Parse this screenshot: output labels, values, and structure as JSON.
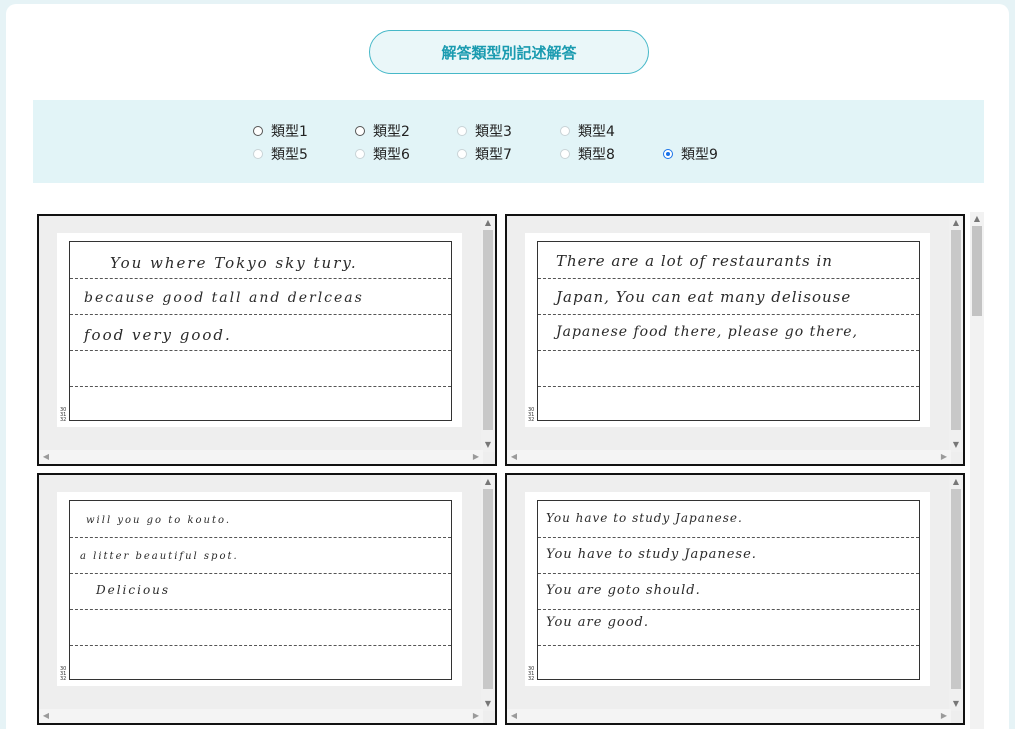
{
  "title": "解答類型別記述解答",
  "types": [
    {
      "label": "類型1",
      "state": "enabled"
    },
    {
      "label": "類型2",
      "state": "enabled"
    },
    {
      "label": "類型3",
      "state": "disabled"
    },
    {
      "label": "類型4",
      "state": "disabled"
    },
    {
      "label": "類型5",
      "state": "disabled"
    },
    {
      "label": "類型6",
      "state": "disabled"
    },
    {
      "label": "類型7",
      "state": "disabled"
    },
    {
      "label": "類型8",
      "state": "disabled"
    },
    {
      "label": "類型9",
      "state": "checked"
    }
  ],
  "answers": [
    {
      "lines": [
        "You where Tokyo sky tury.",
        "because good tall and derlceas",
        "food very good."
      ]
    },
    {
      "lines": [
        "There are a lot of restaurants in",
        "Japan, You can eat many delisouse",
        "Japanese food there, please go there,"
      ]
    },
    {
      "lines": [
        "will you go to kouto.",
        "a litter beautiful spot.",
        "Delicious"
      ]
    },
    {
      "lines": [
        "You have to study Japanese.",
        "You have to study Japanese.",
        "You are goto should.",
        "You are good."
      ]
    }
  ],
  "sheet_footer": [
    "30",
    "31",
    "32"
  ],
  "icons": {
    "scroll_up": "arrow-up-icon",
    "scroll_down": "arrow-down-icon",
    "scroll_left": "arrow-left-icon",
    "scroll_right": "arrow-right-icon"
  }
}
